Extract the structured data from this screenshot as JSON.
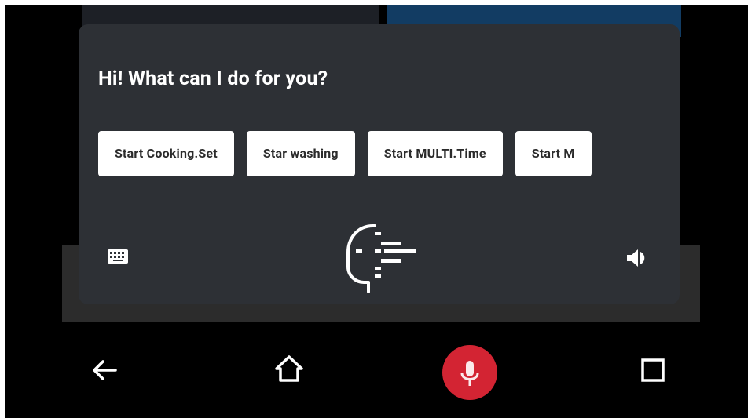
{
  "assistant": {
    "greeting": "Hi! What can I do for you?",
    "suggestions": [
      "Start Cooking.Set",
      "Star washing",
      "Start MULTI.Time",
      "Start M"
    ]
  },
  "icons": {
    "keyboard": "keyboard-icon",
    "assistant": "assistant-face-icon",
    "volume": "volume-icon",
    "back": "back-arrow-icon",
    "home": "home-icon",
    "mic": "microphone-icon",
    "recents": "recents-square-icon"
  },
  "colors": {
    "panel": "#2d3035",
    "mic_button": "#d32433",
    "background_app_blue": "#123c63"
  }
}
